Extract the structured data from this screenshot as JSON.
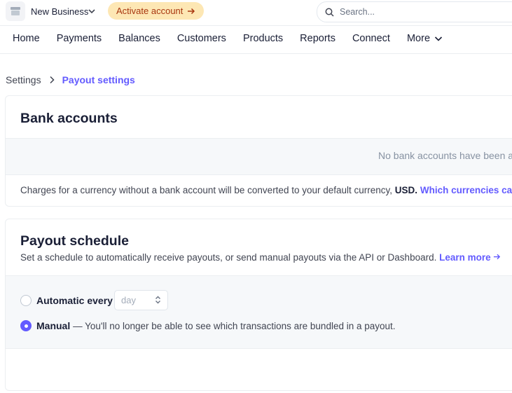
{
  "topbar": {
    "business_name": "New Business",
    "activate_label": "Activate account",
    "search_placeholder": "Search..."
  },
  "nav": {
    "items": [
      "Home",
      "Payments",
      "Balances",
      "Customers",
      "Products",
      "Reports",
      "Connect",
      "More"
    ]
  },
  "breadcrumb": {
    "parent": "Settings",
    "current": "Payout settings"
  },
  "bank_accounts": {
    "title": "Bank accounts",
    "empty_text": "No bank accounts have been added",
    "note_prefix": "Charges for a currency without a bank account will be converted to your default currency,",
    "default_currency": "USD.",
    "note_link": "Which currencies can I use?"
  },
  "payout_schedule": {
    "title": "Payout schedule",
    "description": "Set a schedule to automatically receive payouts, or send manual payouts via the API or Dashboard.",
    "learn_more": "Learn more",
    "option_automatic": "Automatic every",
    "interval_value": "day",
    "option_manual": "Manual",
    "manual_desc": "— You'll no longer be able to see which transactions are bundled in a payout.",
    "selected": "manual"
  },
  "colors": {
    "accent": "#635bff",
    "activate_bg": "#fde7b4",
    "activate_text": "#a8360f"
  }
}
